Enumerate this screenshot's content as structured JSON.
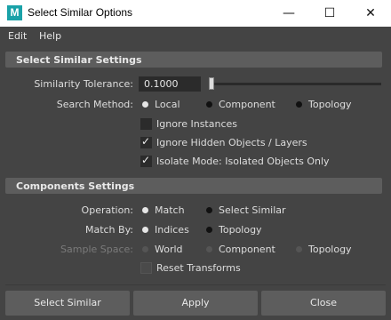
{
  "window": {
    "title": "Select Similar Options",
    "app_icon_letter": "M",
    "minimize_glyph": "—",
    "maximize_glyph": "☐",
    "close_glyph": "✕"
  },
  "menu": {
    "items": [
      "Edit",
      "Help"
    ]
  },
  "select_similar_settings": {
    "header": "Select Similar Settings",
    "similarity_tolerance": {
      "label": "Similarity Tolerance:",
      "value": "0.1000",
      "slider_fraction": 0.01
    },
    "search_method": {
      "label": "Search Method:",
      "options": [
        "Local",
        "Component",
        "Topology"
      ],
      "selected": "Local"
    },
    "ignore_instances": {
      "label": "Ignore Instances",
      "checked": false
    },
    "ignore_hidden": {
      "label": "Ignore Hidden Objects / Layers",
      "checked": true
    },
    "isolate_mode": {
      "label": "Isolate Mode: Isolated Objects Only",
      "checked": true
    }
  },
  "components_settings": {
    "header": "Components Settings",
    "operation": {
      "label": "Operation:",
      "options": [
        "Match",
        "Select Similar"
      ],
      "selected": "Match"
    },
    "match_by": {
      "label": "Match By:",
      "options": [
        "Indices",
        "Topology"
      ],
      "selected": "Indices"
    },
    "sample_space": {
      "label": "Sample Space:",
      "options": [
        "World",
        "Component",
        "Topology"
      ],
      "enabled": false
    },
    "reset_transforms": {
      "label": "Reset Transforms",
      "checked": false,
      "enabled": false
    }
  },
  "buttons": {
    "select_similar": "Select Similar",
    "apply": "Apply",
    "close": "Close"
  },
  "colors": {
    "background": "#444444",
    "header": "#5d5d5d",
    "field": "#2b2b2b",
    "icon": "#1aa2a8"
  }
}
